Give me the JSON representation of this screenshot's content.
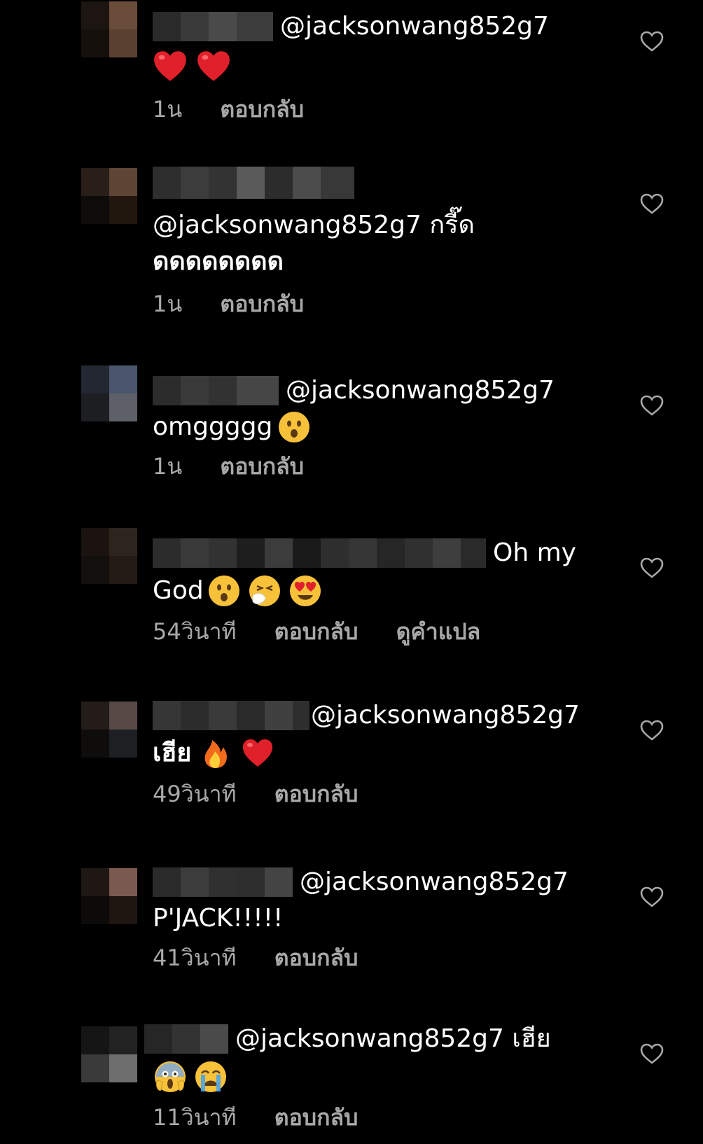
{
  "comments": [
    {
      "author_suffix": "@jacksonwang852g7",
      "text_after_author": "",
      "line2": "",
      "emojis_line1": [],
      "emojis_line2": [
        "red-heart",
        "red-heart"
      ],
      "time": "1น",
      "reply": "ตอบกลับ",
      "translate": ""
    },
    {
      "author_suffix": "",
      "text_after_author": "",
      "line2": "@jacksonwang852g7 กรี๊ด",
      "line3": "ดดดดดดดด",
      "emojis_line1": [],
      "emojis_line2": [],
      "time": "1น",
      "reply": "ตอบกลับ",
      "translate": ""
    },
    {
      "author_suffix": "@jacksonwang852g7",
      "text_after_author": "",
      "line2": "omggggg",
      "emojis_line1": [],
      "emojis_line2": [
        "hushed-face"
      ],
      "time": "1น",
      "reply": "ตอบกลับ",
      "translate": ""
    },
    {
      "author_suffix": "Oh my",
      "text_after_author": "",
      "line2": "God",
      "emojis_line1": [],
      "emojis_line2": [
        "hushed-face",
        "sneezing-face",
        "heart-eyes-face"
      ],
      "time": "54วินาที",
      "reply": "ตอบกลับ",
      "translate": "ดูคำแปล"
    },
    {
      "author_suffix": "@jacksonwang852g7",
      "text_after_author": "",
      "line2": "เฮีย",
      "emojis_line1": [],
      "emojis_line2": [
        "fire",
        "red-heart"
      ],
      "time": "49วินาที",
      "reply": "ตอบกลับ",
      "translate": ""
    },
    {
      "author_suffix": "@jacksonwang852g7",
      "text_after_author": "",
      "line2": "P'JACK!!!!!",
      "emojis_line1": [],
      "emojis_line2": [],
      "time": "41วินาที",
      "reply": "ตอบกลับ",
      "translate": ""
    },
    {
      "author_suffix": "@jacksonwang852g7 เฮีย",
      "text_after_author": "",
      "line2": "",
      "emojis_line1": [],
      "emojis_line2": [
        "screaming-face",
        "crying-face"
      ],
      "time": "11วินาที",
      "reply": "ตอบกลับ",
      "translate": ""
    }
  ],
  "colors": {
    "background": "#000000",
    "text": "#ffffff",
    "meta": "#a8a8a8",
    "heart_outline": "#a8a8a8",
    "emoji_red": "#e0202a",
    "emoji_yellow": "#f7c23a"
  }
}
